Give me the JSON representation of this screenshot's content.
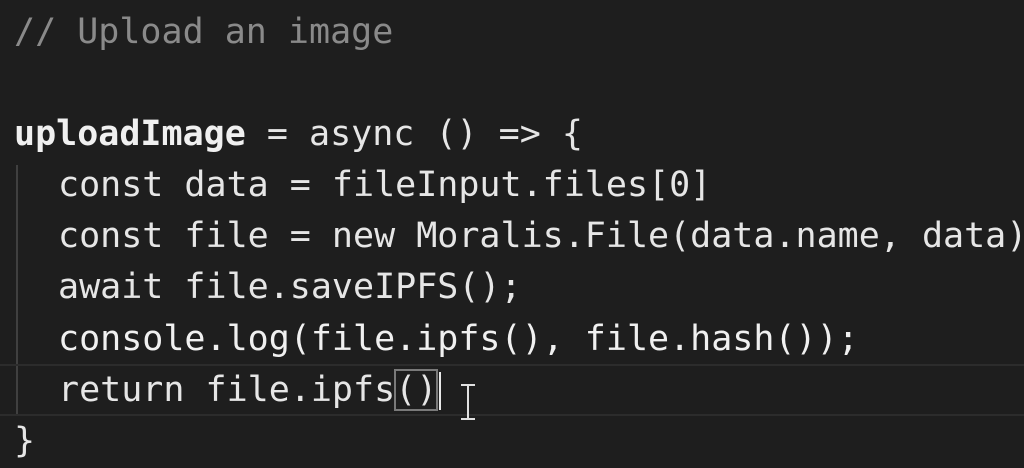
{
  "code": {
    "comment": "// Upload an image",
    "decl_name": "uploadImage",
    "decl_rest": " = async () => {",
    "line_data": "const data = fileInput.files[0]",
    "line_file": "const file = new Moralis.File(data.name, data)",
    "line_await": "await file.saveIPFS();",
    "line_console": "console.log(file.ipfs(), file.hash());",
    "line_return_pre": "return file.ipfs",
    "line_return_paren": "()",
    "close_brace": "}"
  },
  "colors": {
    "background": "#1e1e1e",
    "comment": "#8a8a8a",
    "text": "#e6e6e6"
  }
}
